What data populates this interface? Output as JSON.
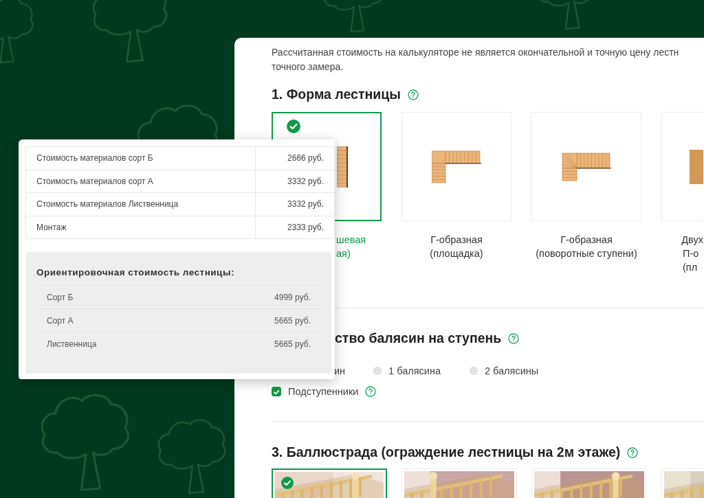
{
  "intro": [
    "Рассчитанная стоимость на калькуляторе не является окончательной и точную цену лестн",
    "точного замера."
  ],
  "section1": {
    "title": "1. Форма лестницы",
    "options": [
      {
        "label": [
          "шевая",
          "ая)"
        ],
        "selected": true,
        "kind": "straight"
      },
      {
        "label": [
          "Г-образная",
          "(площадка)"
        ],
        "selected": false,
        "kind": "landing"
      },
      {
        "label": [
          "Г-образная",
          "(поворотные ступени)"
        ],
        "selected": false,
        "kind": "winder"
      },
      {
        "label": [
          "Двух",
          "П-о",
          "(пл"
        ],
        "selected": false,
        "kind": "double"
      }
    ]
  },
  "section2": {
    "title": "ство балясин на ступень",
    "radio_fragment": "ин",
    "radios": [
      {
        "label": "1 балясина",
        "selected": false
      },
      {
        "label": "2 балясины",
        "selected": false
      }
    ],
    "checkbox": {
      "label": "Подступенники",
      "checked": true
    }
  },
  "section3": {
    "title": "3. Баллюстрада (ограждение лестницы на 2м этаже)",
    "options": [
      {
        "kind": "picture",
        "selected": true
      },
      {
        "kind": "picture",
        "selected": false
      },
      {
        "kind": "picture",
        "selected": false
      },
      {
        "kind": "picture",
        "selected": false
      }
    ]
  },
  "summary": {
    "rows": [
      {
        "label": "Стоимость материалов сорт Б",
        "price": "2666 руб."
      },
      {
        "label": "Стоимость материалов сорт А",
        "price": "3332 руб."
      },
      {
        "label": "Стоимость материалов Лиственница",
        "price": "3332 руб."
      },
      {
        "label": "Монтаж",
        "price": "2333 руб."
      }
    ],
    "estimate": {
      "title": "Ориентировочная стоимость лестницы:",
      "rows": [
        {
          "label": "Сорт Б",
          "price": "4999 руб."
        },
        {
          "label": "Сорт А",
          "price": "5665 руб."
        },
        {
          "label": "Лиственница",
          "price": "5665 руб."
        }
      ]
    }
  }
}
